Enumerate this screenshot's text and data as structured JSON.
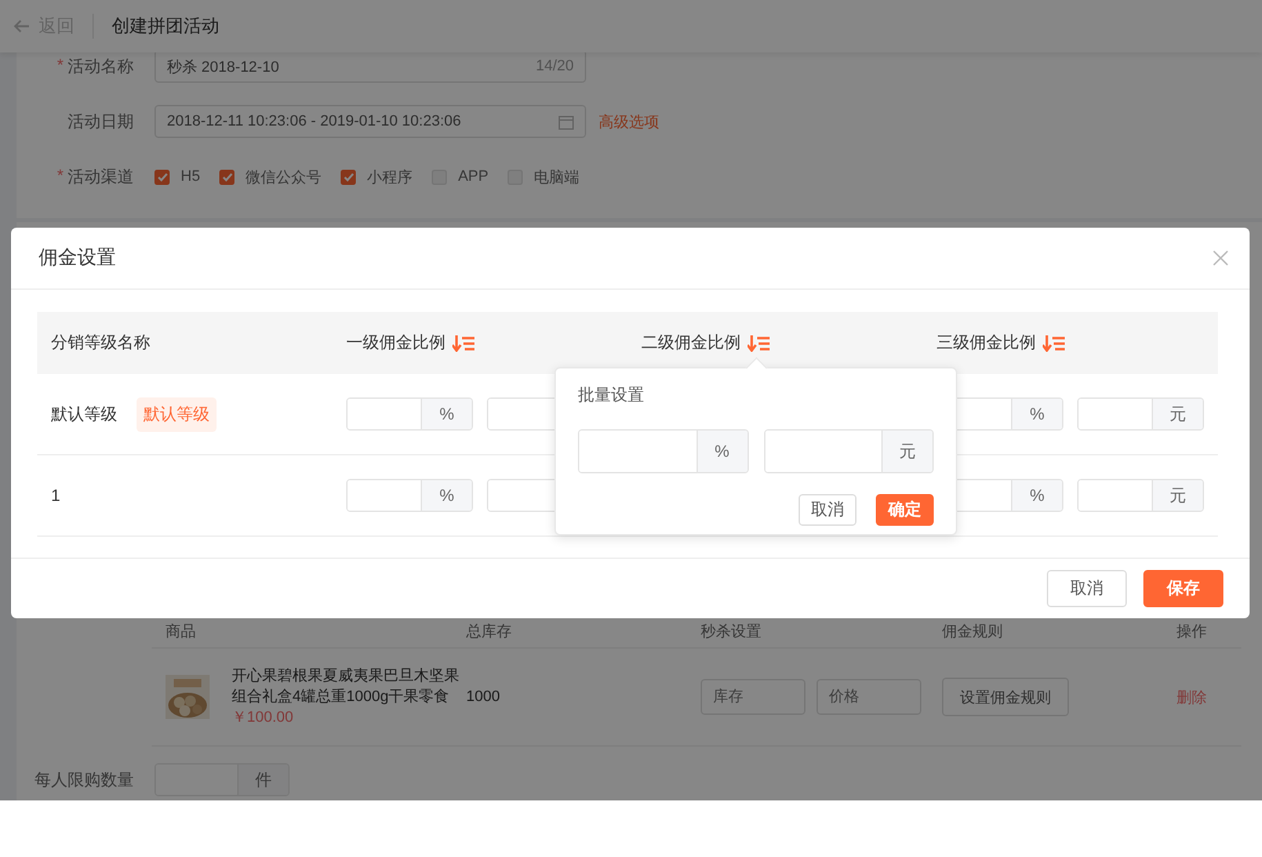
{
  "header": {
    "back_label": "返回",
    "title": "创建拼团活动"
  },
  "form": {
    "name_field": {
      "required_mark": "*",
      "label": "活动名称",
      "value": "秒杀 2018-12-10",
      "count": "14/20"
    },
    "date_field": {
      "label": "活动日期",
      "value": "2018-12-11 10:23:06 - 2019-01-10 10:23:06",
      "link": "高级选项"
    },
    "channels": {
      "required_mark": "*",
      "label": "活动渠道",
      "options": [
        {
          "label": "H5",
          "checked": true
        },
        {
          "label": "微信公众号",
          "checked": true
        },
        {
          "label": "小程序",
          "checked": true
        },
        {
          "label": "APP",
          "checked": false
        },
        {
          "label": "电脑端",
          "checked": false
        }
      ]
    }
  },
  "products": {
    "columns": [
      "商品",
      "总库存",
      "秒杀设置",
      "佣金规则",
      "操作"
    ],
    "rows": [
      {
        "kind": "picture",
        "name": "开心果碧根果夏威夷果巴旦木坚果组合礼盒4罐总重1000g干果零食",
        "price": "￥100.00",
        "stock": "1000",
        "stock_placeholder": "库存",
        "price_placeholder": "价格",
        "rule_button": "设置佣金规则",
        "action": "删除"
      }
    ]
  },
  "limit": {
    "label": "每人限购数量",
    "unit": "件"
  },
  "dialog": {
    "title": "佣金设置",
    "columns": [
      {
        "label": "分销等级名称",
        "sortable": false
      },
      {
        "label": "一级佣金比例",
        "sortable": true
      },
      {
        "label": "二级佣金比例",
        "sortable": true
      },
      {
        "label": "三级佣金比例",
        "sortable": true
      }
    ],
    "rows": [
      {
        "name": "默认等级",
        "tag": "默认等级",
        "cells": [
          {
            "percent_unit": "%"
          },
          {
            "percent_unit": "%",
            "amount_unit": "元"
          }
        ]
      },
      {
        "name": "1",
        "cells": [
          {
            "percent_unit": "%"
          },
          {
            "percent_unit": "%",
            "amount_unit": "元"
          }
        ]
      }
    ],
    "buttons": [
      {
        "label": "取消",
        "primary": false
      },
      {
        "label": "保存",
        "primary": true
      }
    ]
  },
  "popover": {
    "title": "批量设置",
    "percent_unit": "%",
    "amount_unit": "元",
    "buttons": [
      {
        "label": "取消",
        "primary": false
      },
      {
        "label": "确定",
        "primary": true
      }
    ]
  }
}
